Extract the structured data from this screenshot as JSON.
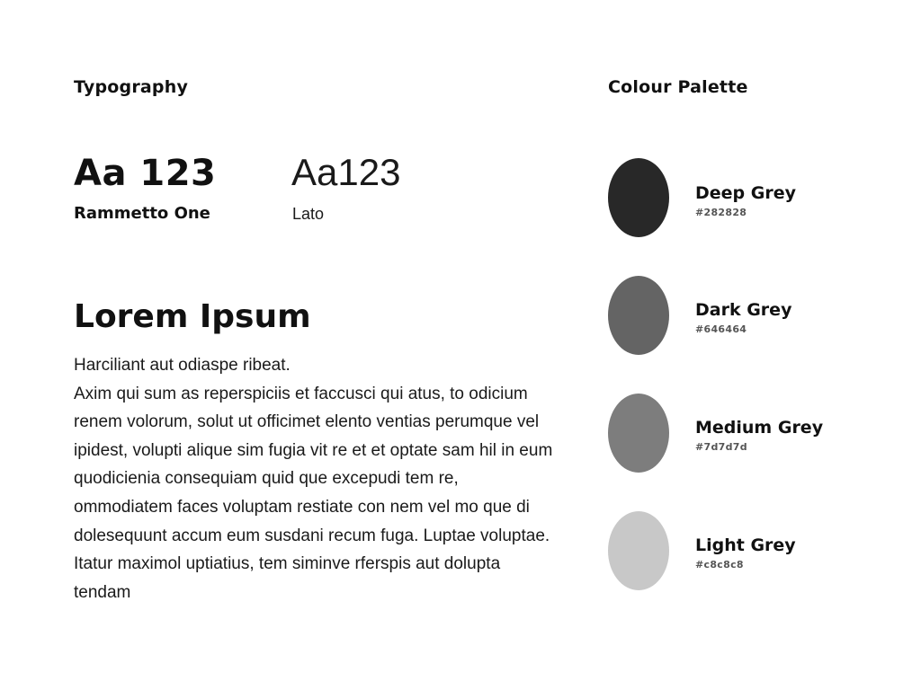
{
  "typography": {
    "title": "Typography",
    "display_sample": "Aa 123",
    "display_font_name": "Rammetto One",
    "body_sample": "Aa123",
    "body_font_name": "Lato",
    "heading": "Lorem Ipsum",
    "paragraph_lines": [
      "Harciliant aut odiaspe ribeat.",
      "Axim qui sum as reperspiciis et faccusci qui atus, to odicium renem volorum, solut ut officimet elento ventias perumque vel ipidest, volupti alique sim fugia vit re et et optate sam hil in eum quodicienia consequiam quid que excepudi tem re, ommodiatem faces voluptam restiate con nem vel mo que di dolesequunt accum eum susdani recum fuga. Luptae voluptae. Itatur maximol uptiatius, tem siminve rferspis aut dolupta tendam"
    ]
  },
  "palette": {
    "title": "Colour Palette",
    "colors": [
      {
        "name": "Deep Grey",
        "hex": "#282828",
        "color": "#282828"
      },
      {
        "name": "Dark Grey",
        "hex": "#646464",
        "color": "#646464"
      },
      {
        "name": "Medium Grey",
        "hex": "#7d7d7d",
        "color": "#7d7d7d"
      },
      {
        "name": "Light Grey",
        "hex": "#c8c8c8",
        "color": "#c8c8c8"
      }
    ]
  }
}
